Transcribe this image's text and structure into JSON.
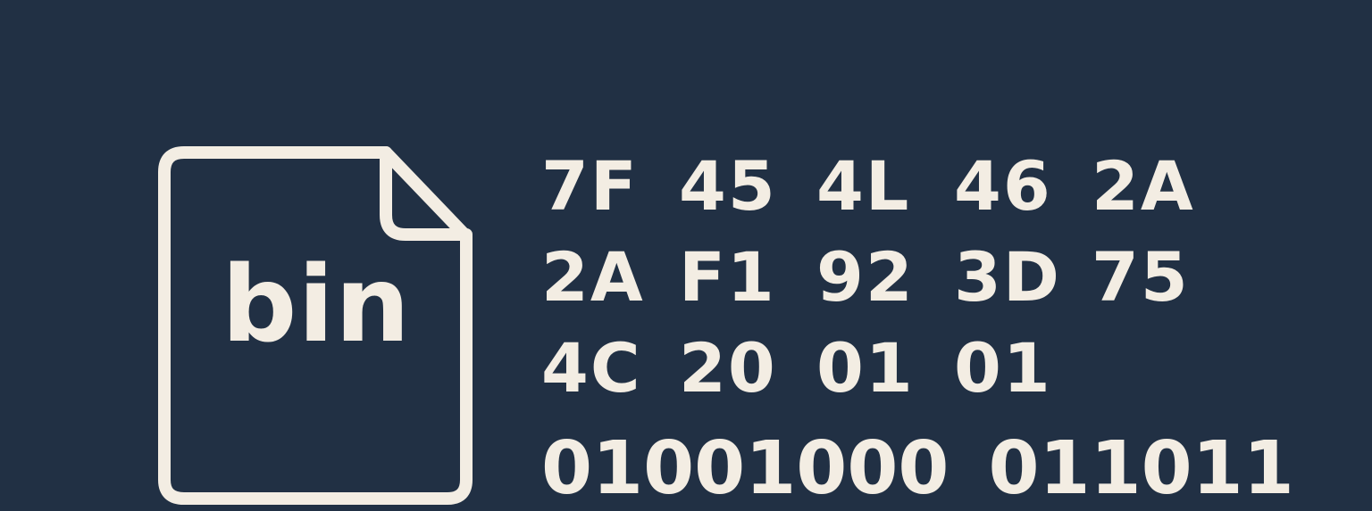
{
  "colors": {
    "background": "#213044",
    "foreground": "#f3ede3"
  },
  "file_icon": {
    "icon": "file-icon",
    "label": "bin"
  },
  "hex_rows": [
    [
      "7F",
      "45",
      "4L",
      "46",
      "2A"
    ],
    [
      "2A",
      "F1",
      "92",
      "3D",
      "75"
    ],
    [
      "4C",
      "20",
      "01",
      "01"
    ]
  ],
  "binary": [
    "01001000",
    "011011"
  ]
}
